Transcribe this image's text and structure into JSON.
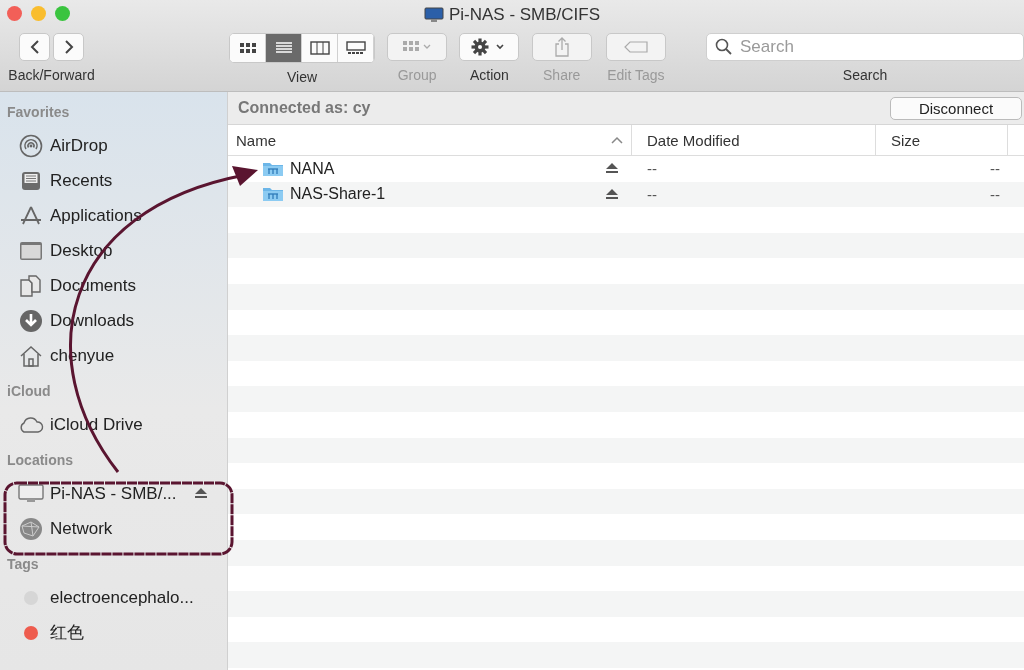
{
  "window": {
    "title": "Pi-NAS - SMB/CIFS"
  },
  "toolbar": {
    "nav": {
      "label": "Back/Forward"
    },
    "view": {
      "label": "View",
      "modes": [
        {
          "kind": "icons",
          "selected": false
        },
        {
          "kind": "list",
          "selected": true
        },
        {
          "kind": "columns",
          "selected": false
        },
        {
          "kind": "gallery",
          "selected": false
        }
      ]
    },
    "tools": [
      {
        "kind": "group",
        "label": "Group",
        "disabled": true
      },
      {
        "kind": "action",
        "label": "Action",
        "disabled": false
      },
      {
        "kind": "share",
        "label": "Share",
        "disabled": true
      },
      {
        "kind": "tags",
        "label": "Edit Tags",
        "disabled": true
      }
    ],
    "search": {
      "placeholder": "Search",
      "label": "Search"
    }
  },
  "sidebar": {
    "sections": [
      {
        "title": "Favorites",
        "items": [
          {
            "kind": "airdrop",
            "name": "AirDrop"
          },
          {
            "kind": "recents",
            "name": "Recents"
          },
          {
            "kind": "applications",
            "name": "Applications"
          },
          {
            "kind": "desktop",
            "name": "Desktop"
          },
          {
            "kind": "documents",
            "name": "Documents"
          },
          {
            "kind": "downloads",
            "name": "Downloads"
          },
          {
            "kind": "home",
            "name": "chenyue"
          }
        ]
      },
      {
        "title": "iCloud",
        "items": [
          {
            "kind": "cloud",
            "name": "iCloud Drive"
          }
        ]
      },
      {
        "title": "Locations",
        "items": [
          {
            "kind": "computer",
            "name": "Pi-NAS - SMB/...",
            "eject": true
          },
          {
            "kind": "network",
            "name": "Network"
          }
        ]
      },
      {
        "title": "Tags",
        "items": [
          {
            "kind": "tag",
            "name": "electroencephalo...",
            "color": "#d6d6d6"
          },
          {
            "kind": "tag",
            "name": "红色",
            "color": "#ee5c4e"
          }
        ]
      }
    ]
  },
  "content": {
    "connection": "Connected as: cy",
    "disconnect": "Disconnect",
    "columns": [
      {
        "label": "Name",
        "sorted": true
      },
      {
        "label": "Date Modified",
        "sorted": false
      },
      {
        "label": "Size",
        "sorted": false
      }
    ],
    "rows": [
      {
        "name": "NANA",
        "date": "--",
        "size": "--",
        "eject": true
      },
      {
        "name": "NAS-Share-1",
        "date": "--",
        "size": "--",
        "eject": true
      }
    ]
  }
}
